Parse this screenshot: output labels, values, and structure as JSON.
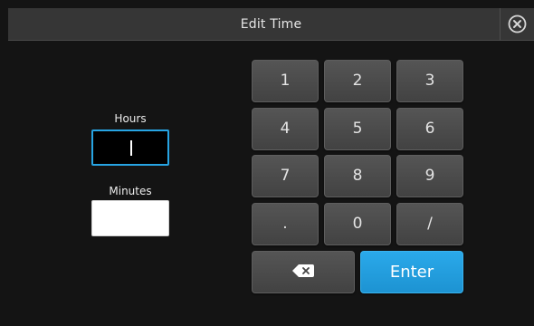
{
  "dialog": {
    "title": "Edit Time",
    "close_icon": "close-circle-icon"
  },
  "fields": {
    "hours": {
      "label": "Hours",
      "value": ""
    },
    "minutes": {
      "label": "Minutes",
      "value": ""
    }
  },
  "keypad": {
    "keys": [
      "1",
      "2",
      "3",
      "4",
      "5",
      "6",
      "7",
      "8",
      "9",
      ".",
      "0",
      "/"
    ],
    "backspace_icon": "backspace-icon",
    "enter_label": "Enter"
  },
  "colors": {
    "accent": "#27a4e3",
    "enter_button": "#22a0e0",
    "key_background": "#4b4b4b",
    "titlebar": "#363636",
    "background": "#141414"
  }
}
